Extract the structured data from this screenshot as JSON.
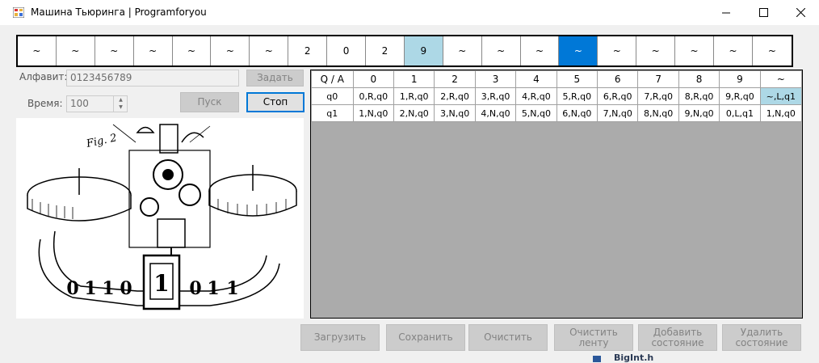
{
  "window": {
    "title": "Машина Тьюринга | Programforyou",
    "minimize_icon": "minimize-icon",
    "maximize_icon": "maximize-icon",
    "close_icon": "close-icon"
  },
  "tape": {
    "cells": [
      "~",
      "~",
      "~",
      "~",
      "~",
      "~",
      "~",
      "2",
      "0",
      "2",
      "9",
      "~",
      "~",
      "~",
      "~",
      "~",
      "~",
      "~",
      "~",
      "~"
    ],
    "highlighted_index": 10,
    "head_index": 14
  },
  "controls": {
    "alphabet_label": "Алфавит:",
    "alphabet_value": "0123456789",
    "set_button": "Задать",
    "time_label": "Время:",
    "time_value": "100",
    "start_button": "Пуск",
    "stop_button": "Стоп"
  },
  "table": {
    "header": [
      "Q / A",
      "0",
      "1",
      "2",
      "3",
      "4",
      "5",
      "6",
      "7",
      "8",
      "9",
      "~"
    ],
    "rows": [
      [
        "q0",
        "0,R,q0",
        "1,R,q0",
        "2,R,q0",
        "3,R,q0",
        "4,R,q0",
        "5,R,q0",
        "6,R,q0",
        "7,R,q0",
        "8,R,q0",
        "9,R,q0",
        "~,L,q1"
      ],
      [
        "q1",
        "1,N,q0",
        "2,N,q0",
        "3,N,q0",
        "4,N,q0",
        "5,N,q0",
        "6,N,q0",
        "7,N,q0",
        "8,N,q0",
        "9,N,q0",
        "0,L,q1",
        "1,N,q0"
      ]
    ],
    "selected_cell": [
      0,
      11
    ]
  },
  "bottom_buttons": {
    "load": "Загрузить",
    "save": "Сохранить",
    "clear": "Очистить",
    "clear_tape": "Очистить ленту",
    "add_state_1": "Добавить",
    "add_state_2": "состояние",
    "remove_state_1": "Удалить",
    "remove_state_2": "состояние"
  },
  "illustration": {
    "caption": "Fig. 2",
    "tape_digits": [
      "0",
      "1",
      "1",
      "0",
      "1",
      "0",
      "1",
      "1"
    ]
  },
  "background_window": {
    "text": "BigInt.h"
  },
  "colors": {
    "highlight": "#add8e6",
    "head": "#0078d7",
    "grid_bg": "#ababab",
    "button_disabled": "#cccccc",
    "focus_border": "#0078d7"
  }
}
